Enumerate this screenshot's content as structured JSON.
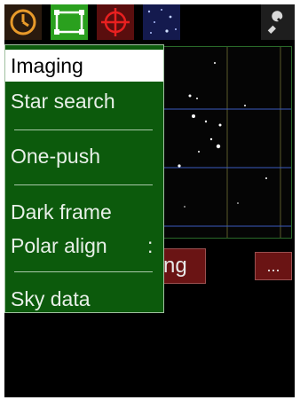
{
  "toolbar": {
    "clock_icon": "clock-icon",
    "frame_icon": "frame-icon",
    "target_icon": "crosshair-icon",
    "stars_icon": "stars-icon",
    "wrench_icon": "wrench-icon"
  },
  "menu": {
    "items": [
      {
        "label": "Imaging",
        "selected": true
      },
      {
        "label": "Star search"
      },
      {
        "label": "One-push"
      },
      {
        "label": "Dark frame"
      },
      {
        "label": "Polar align",
        "suffix": ":"
      },
      {
        "label": "Sky data"
      }
    ]
  },
  "main": {
    "start_button_label": "ng",
    "more_button_label": "..."
  },
  "colors": {
    "accent_green": "#2aa01e",
    "menu_bg": "#0c5a0c",
    "button_red": "#6a1414"
  }
}
